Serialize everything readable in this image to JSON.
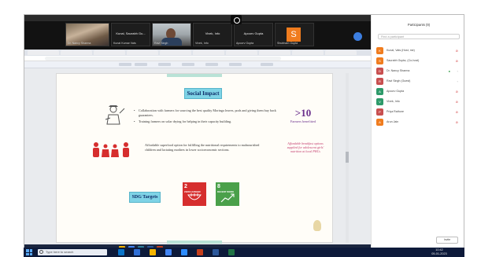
{
  "meeting": {
    "tiles": [
      {
        "caption": "Dr. Nancy Sharma",
        "kind": "photo"
      },
      {
        "caption": "Kunal Kumar Vats",
        "name": "Kunal, Saurabh Gu...",
        "kind": "name"
      },
      {
        "caption": "Ravi Singh",
        "kind": "face"
      },
      {
        "caption": "Vivek, Info",
        "name": "Vivek, Info",
        "kind": "name"
      },
      {
        "caption": "Apoorv Gupta",
        "name": "Apoorv Gupta",
        "kind": "name"
      },
      {
        "caption": "Shubham Gupta",
        "initial": "S",
        "kind": "initial"
      }
    ]
  },
  "slide": {
    "title": "Social Impact",
    "bullets": [
      "Collaboration with farmers for sourcing the best quality Moringa leaves, pods and giving them buy back guarantees.",
      "Training farmers on solar drying for helping in their capacity building."
    ],
    "stat_number": ">10",
    "stat_label": "Farmers benefitted",
    "mid_text": "Affordable superfood option for fulfilling the nutritional requirements to malnourished children and lactating mothers in lower socioeconomic sections.",
    "pink_text": "Affordable breakfast options supplied for adolescent girls' nutrition at local PHCs",
    "sdg_title": "SDG Targets",
    "sdg": [
      {
        "number": "2",
        "label": "ZERO HUNGER",
        "color": "#d62e2e"
      },
      {
        "number": "8",
        "label": "DECENT WORK",
        "color": "#4aa04a"
      }
    ]
  },
  "participants": {
    "header": "Participants (9)",
    "search_placeholder": "Find a participant",
    "people": [
      {
        "initial": "K",
        "name": "Kunal, Vats (Host, me)",
        "color": "#f07c1e",
        "cam": false
      },
      {
        "initial": "S",
        "name": "Saurabh Gupta, (Co-host)",
        "color": "#f07c1e",
        "cam": false
      },
      {
        "initial": "D",
        "name": "Dr. Nancy Sharma",
        "color": "#c84f4f",
        "cam": true
      },
      {
        "initial": "R",
        "name": "Ravi Singh (Guest)",
        "color": "#c84f4f",
        "cam": false
      },
      {
        "initial": "A",
        "name": "Apoorv Gupta",
        "color": "#2e9a6a",
        "cam": false
      },
      {
        "initial": "V",
        "name": "Vivek, Info",
        "color": "#2e9a6a",
        "cam": false
      },
      {
        "initial": "P",
        "name": "Priya Rathore",
        "color": "#c84f4f",
        "cam": false
      },
      {
        "initial": "A",
        "name": "Arun Jain",
        "color": "#f07c1e",
        "cam": false
      }
    ],
    "invite_label": "Invite"
  },
  "taskbar": {
    "search_placeholder": "Type here to search",
    "time": "10:42",
    "date": "05-01-2023"
  },
  "colors": {
    "title_box": "#7fd3e6",
    "stat_purple": "#6a2f8c",
    "pink": "#c2386b",
    "people_red": "#d62e2e"
  }
}
